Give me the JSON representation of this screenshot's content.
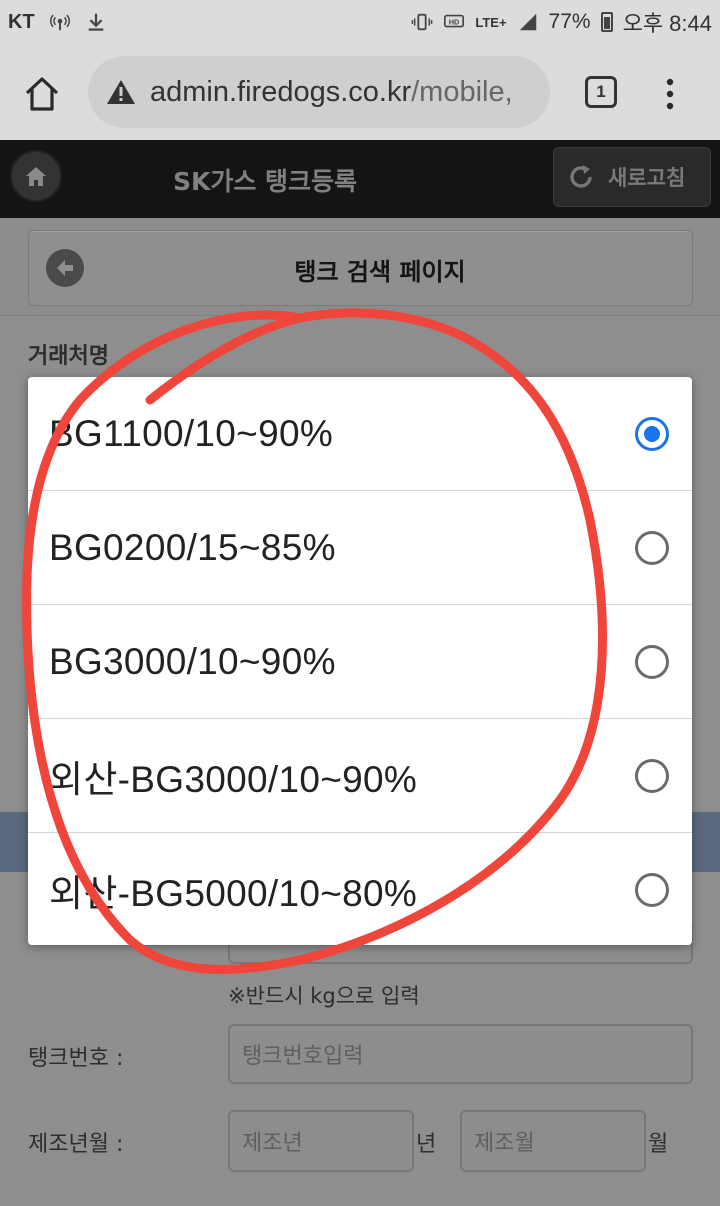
{
  "status_bar": {
    "carrier": "KT",
    "network": "LTE+",
    "battery": "77%",
    "time": "오후 8:44"
  },
  "browser": {
    "url_domain": "admin.firedogs.co.kr",
    "url_path": "/mobile,",
    "tab_count": "1"
  },
  "app_header": {
    "title": "SK가스 탱크등록",
    "refresh_label": "새로고침"
  },
  "sub_header": {
    "title": "탱크 검색 페이지"
  },
  "form": {
    "client_label": "거래처명",
    "weight_note": "※반드시 kg으로 입력",
    "tank_number_label": "탱크번호 :",
    "tank_number_placeholder": "탱크번호입력",
    "mfg_date_label": "제조년월 :",
    "year_placeholder": "제조년",
    "year_suffix": "년",
    "month_placeholder": "제조월",
    "month_suffix": "월"
  },
  "dialog": {
    "options": [
      {
        "label": "BG1100/10~90%",
        "selected": true
      },
      {
        "label": "BG0200/15~85%",
        "selected": false
      },
      {
        "label": "BG3000/10~90%",
        "selected": false
      },
      {
        "label": "외산-BG3000/10~90%",
        "selected": false
      },
      {
        "label": "외산-BG5000/10~80%",
        "selected": false
      }
    ]
  },
  "colors": {
    "accent": "#1a73e8",
    "annotation": "#f0453a",
    "header_bg": "#141414"
  }
}
